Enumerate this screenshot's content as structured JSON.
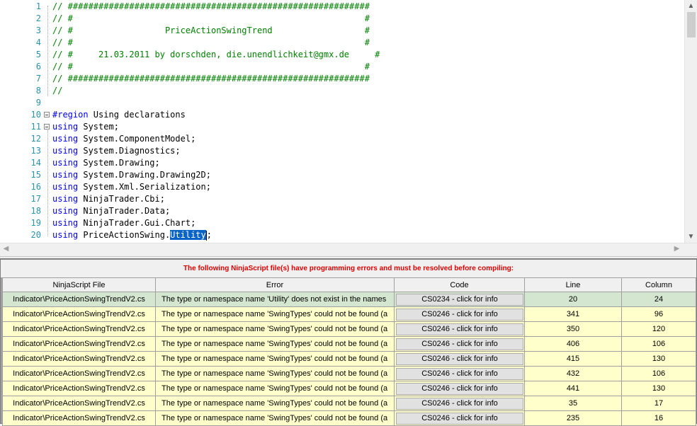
{
  "editor": {
    "lines": [
      {
        "num": "1",
        "kind": "comment",
        "text": "// ###########################################################"
      },
      {
        "num": "2",
        "kind": "comment",
        "text": "// #                                                         #"
      },
      {
        "num": "3",
        "kind": "comment",
        "text": "// #                  PriceActionSwingTrend                  #"
      },
      {
        "num": "4",
        "kind": "comment",
        "text": "// #                                                         #"
      },
      {
        "num": "5",
        "kind": "comment",
        "text": "// #     21.03.2011 by dorschden, die.unendlichkeit@gmx.de     #"
      },
      {
        "num": "6",
        "kind": "comment",
        "text": "// #                                                         #"
      },
      {
        "num": "7",
        "kind": "comment",
        "text": "// ###########################################################"
      },
      {
        "num": "8",
        "kind": "comment",
        "text": "//"
      },
      {
        "num": "9",
        "kind": "blank",
        "text": ""
      },
      {
        "num": "10",
        "kind": "region",
        "kw": "#region",
        "text": " Using declarations"
      },
      {
        "num": "11",
        "kind": "using",
        "kw": "using",
        "text": " System;"
      },
      {
        "num": "12",
        "kind": "using",
        "kw": "using",
        "text": " System.ComponentModel;"
      },
      {
        "num": "13",
        "kind": "using",
        "kw": "using",
        "text": " System.Diagnostics;"
      },
      {
        "num": "14",
        "kind": "using",
        "kw": "using",
        "text": " System.Drawing;"
      },
      {
        "num": "15",
        "kind": "using",
        "kw": "using",
        "text": " System.Drawing.Drawing2D;"
      },
      {
        "num": "16",
        "kind": "using",
        "kw": "using",
        "text": " System.Xml.Serialization;"
      },
      {
        "num": "17",
        "kind": "using",
        "kw": "using",
        "text": " NinjaTrader.Cbi;"
      },
      {
        "num": "18",
        "kind": "using",
        "kw": "using",
        "text": " NinjaTrader.Data;"
      },
      {
        "num": "19",
        "kind": "using",
        "kw": "using",
        "text": " NinjaTrader.Gui.Chart;"
      },
      {
        "num": "20",
        "kind": "using-sel",
        "kw": "using",
        "text": " PriceActionSwing.",
        "selected": "Utility",
        "after": ";"
      }
    ]
  },
  "errors": {
    "title": "The following NinjaScript file(s) have programming errors and must be resolved before compiling:",
    "columns": [
      "NinjaScript File",
      "Error",
      "Code",
      "Line",
      "Column"
    ],
    "rows": [
      {
        "file": "Indicator\\PriceActionSwingTrendV2.cs",
        "error": "The type or namespace name 'Utility' does not exist in the names",
        "code": "CS0234 - click for info",
        "line": "20",
        "column": "24"
      },
      {
        "file": "Indicator\\PriceActionSwingTrendV2.cs",
        "error": "The type or namespace name 'SwingTypes' could not be found (a",
        "code": "CS0246 - click for info",
        "line": "341",
        "column": "96"
      },
      {
        "file": "Indicator\\PriceActionSwingTrendV2.cs",
        "error": "The type or namespace name 'SwingTypes' could not be found (a",
        "code": "CS0246 - click for info",
        "line": "350",
        "column": "120"
      },
      {
        "file": "Indicator\\PriceActionSwingTrendV2.cs",
        "error": "The type or namespace name 'SwingTypes' could not be found (a",
        "code": "CS0246 - click for info",
        "line": "406",
        "column": "106"
      },
      {
        "file": "Indicator\\PriceActionSwingTrendV2.cs",
        "error": "The type or namespace name 'SwingTypes' could not be found (a",
        "code": "CS0246 - click for info",
        "line": "415",
        "column": "130"
      },
      {
        "file": "Indicator\\PriceActionSwingTrendV2.cs",
        "error": "The type or namespace name 'SwingTypes' could not be found (a",
        "code": "CS0246 - click for info",
        "line": "432",
        "column": "106"
      },
      {
        "file": "Indicator\\PriceActionSwingTrendV2.cs",
        "error": "The type or namespace name 'SwingTypes' could not be found (a",
        "code": "CS0246 - click for info",
        "line": "441",
        "column": "130"
      },
      {
        "file": "Indicator\\PriceActionSwingTrendV2.cs",
        "error": "The type or namespace name 'SwingTypes' could not be found (a",
        "code": "CS0246 - click for info",
        "line": "35",
        "column": "17"
      },
      {
        "file": "Indicator\\PriceActionSwingTrendV2.cs",
        "error": "The type or namespace name 'SwingTypes' could not be found (a",
        "code": "CS0246 - click for info",
        "line": "235",
        "column": "16"
      }
    ]
  },
  "colors": {
    "comment": "#008000",
    "keyword": "#0000ff",
    "line_number": "#2b91af",
    "error_title": "#e00000",
    "row_selected": "#d5e6d0",
    "row_normal": "#ffffcc"
  },
  "icons": {
    "scroll_up": "▲",
    "scroll_down": "▼",
    "scroll_left": "◀",
    "scroll_right": "▶"
  }
}
